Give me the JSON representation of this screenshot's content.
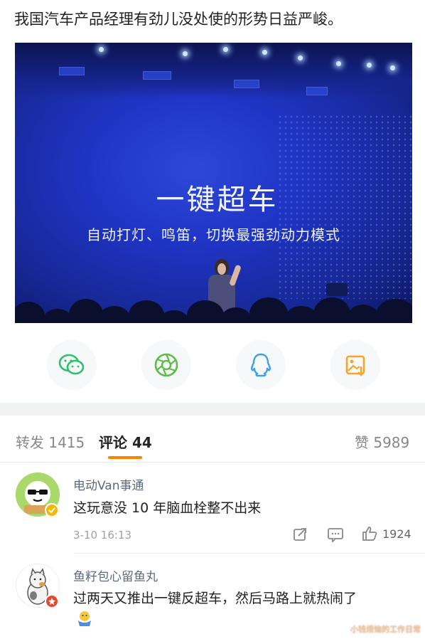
{
  "post": {
    "text": "我国汽车产品经理有劲儿没处使的形势日益严峻。",
    "image": {
      "slide_title": "一键超车",
      "slide_subtitle": "自动打灯、鸣笛，切换最强劲动力模式"
    }
  },
  "share": {
    "icons": [
      "wechat-icon",
      "moments-icon",
      "qq-icon",
      "save-image-icon"
    ],
    "colors": {
      "wechat": "#29c46a",
      "moments": "#5dbb46",
      "qq": "#3aa0f0",
      "save": "#f5a623"
    }
  },
  "tabs": {
    "repost_label": "转发",
    "repost_count": "1415",
    "comment_label": "评论",
    "comment_count": "44",
    "like_label": "赞",
    "like_count": "5989"
  },
  "comments": [
    {
      "user": "电动Van事通",
      "text": "这玩意没 10 年脑血栓整不出来",
      "time": "3-10 16:13",
      "likes": "1924"
    },
    {
      "user": "鱼籽包心留鱼丸",
      "text": "过两天又推出一键反超车，然后马路上就热闹了"
    }
  ],
  "watermark": "小钱烦恼的工作日常",
  "accent_color": "#ff8200"
}
